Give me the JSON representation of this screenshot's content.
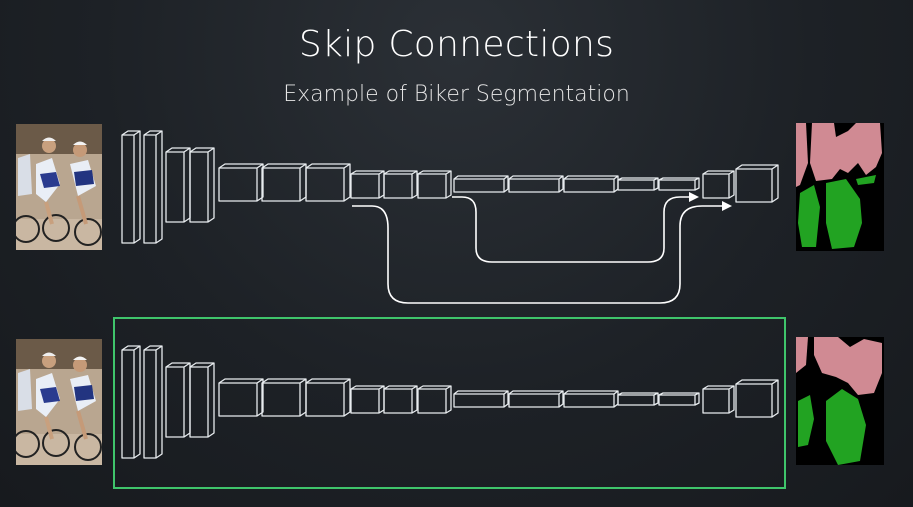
{
  "slide": {
    "title": "Skip Connections",
    "subtitle": "Example of Biker Segmentation"
  },
  "colors": {
    "highlight_box": "#3fc46b",
    "network_stroke": "#e8ecef",
    "arrow": "#ffffff",
    "seg_person": "#d08a93",
    "seg_bike": "#22a322",
    "seg_background": "#000000"
  },
  "rows": [
    {
      "name": "with-skip-connections",
      "skip_connections": 2,
      "highlighted": false
    },
    {
      "name": "without-skip-connections",
      "skip_connections": 0,
      "highlighted": true
    }
  ]
}
